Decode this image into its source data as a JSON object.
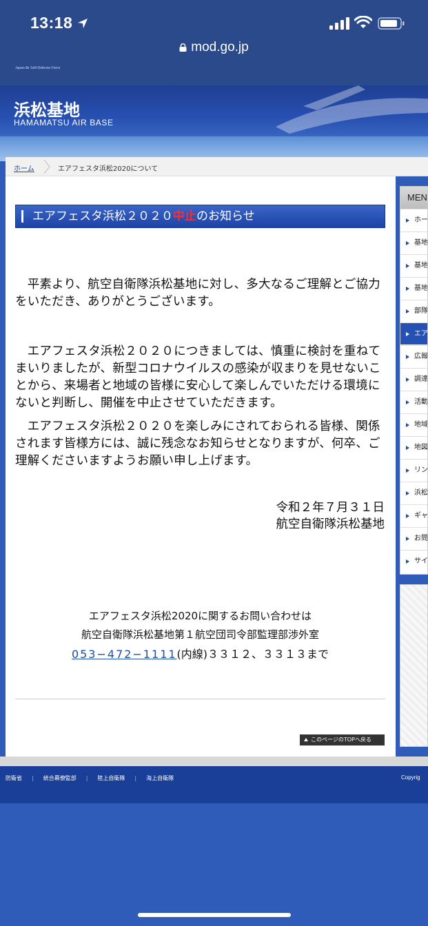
{
  "status": {
    "time": "13:18",
    "url": "mod.go.jp"
  },
  "header": {
    "tagline": "Japan Air Self-Defense Force",
    "title": "浜松基地",
    "subtitle": "HAMAMATSU AIR BASE"
  },
  "breadcrumb": {
    "home": "ホーム",
    "current": "エアフェスタ浜松2020について"
  },
  "notice": {
    "title_before": "エアフェスタ浜松２０２０",
    "title_highlight": "中止",
    "title_after": "のお知らせ",
    "para1": "　平素より、航空自衛隊浜松基地に対し、多大なるご理解とご協力をいただき、ありがとうございます。",
    "para2": "　エアフェスタ浜松２０２０につきましては、慎重に検討を重ねてまいりましたが、新型コロナウイルスの感染が収まりを見せないことから、来場者と地域の皆様に安心して楽しんでいただける環境にないと判断し、開催を中止させていただきます。",
    "para3": "　エアフェスタ浜松２０２０を楽しみにされておられる皆様、関係されます皆様方には、誠に残念なお知らせとなりますが、何卒、ご理解くださいますようお願い申し上げます。",
    "date": "令和２年７月３１日",
    "signer": "航空自衛隊浜松基地"
  },
  "contact": {
    "line1": "エアフェスタ浜松2020に関するお問い合わせは",
    "line2": "航空自衛隊浜松基地第１航空団司令部監理部渉外室",
    "phone": "053−472−1111",
    "line3_rest": "(内線)３３１２、３３１３まで"
  },
  "to_top": "このページのTOPへ戻る",
  "menu": {
    "heading": "MEN",
    "items": [
      {
        "label": "ホー",
        "active": false
      },
      {
        "label": "基地",
        "active": false
      },
      {
        "label": "基地",
        "active": false
      },
      {
        "label": "基地",
        "active": false
      },
      {
        "label": "部隊",
        "active": false
      },
      {
        "label": "エア",
        "active": true
      },
      {
        "label": "広報",
        "active": false
      },
      {
        "label": "調達",
        "active": false
      },
      {
        "label": "活動",
        "active": false
      },
      {
        "label": "地域",
        "active": false
      },
      {
        "label": "地図",
        "active": false
      },
      {
        "label": "リン",
        "active": false
      },
      {
        "label": "浜松",
        "active": false
      },
      {
        "label": "ギャ",
        "active": false
      },
      {
        "label": "お問",
        "active": false
      },
      {
        "label": "サイ",
        "active": false
      }
    ]
  },
  "footer": {
    "links": [
      "防衛省",
      "統合幕僚監部",
      "陸上自衛隊",
      "海上自衛隊"
    ],
    "copyright": "Copyrig"
  },
  "colors": {
    "brand_blue": "#1d43a6",
    "highlight_red": "#ff2b2b",
    "link_blue": "#1a4da3"
  }
}
